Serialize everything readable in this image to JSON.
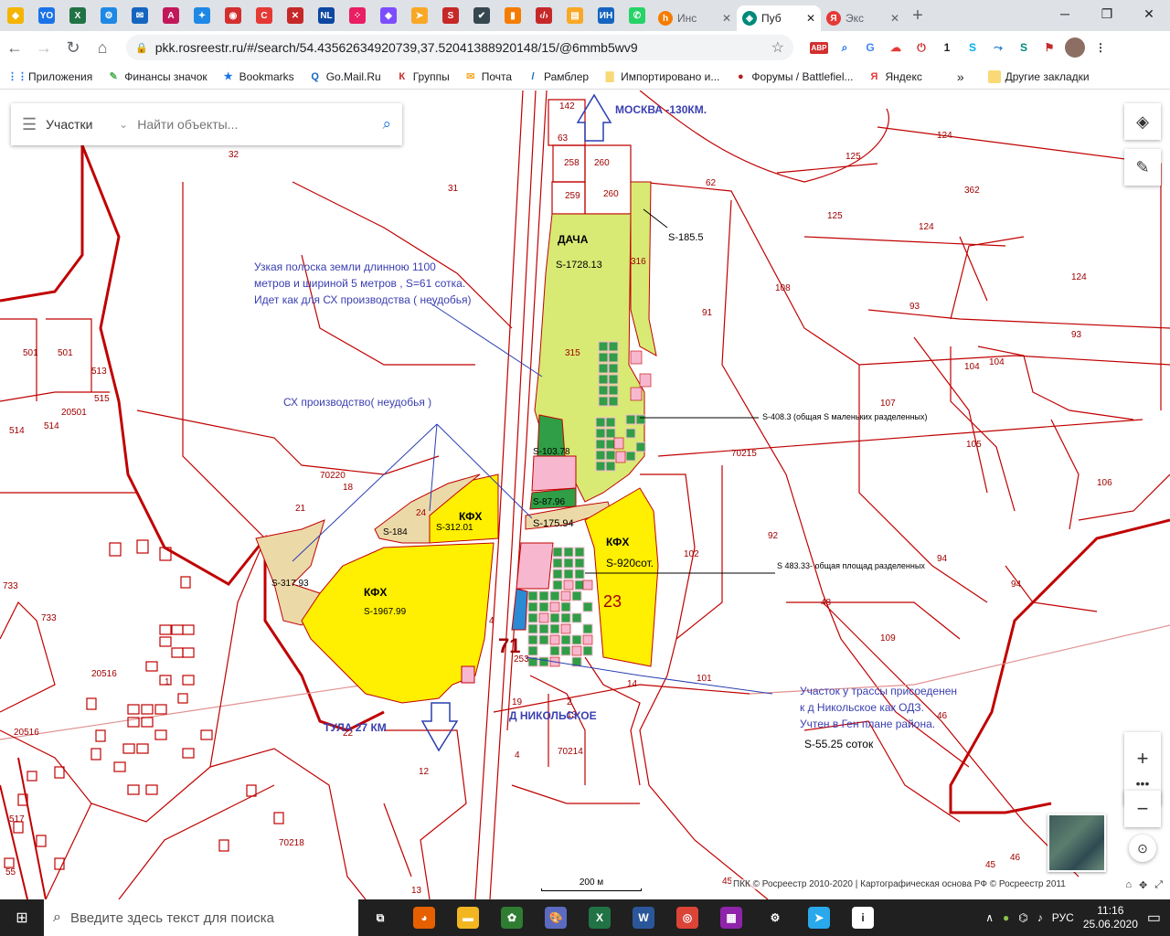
{
  "browser": {
    "tabs_icons": [
      {
        "name": "bookmark-yellow-icon",
        "glyph": "◆",
        "color": "#f5b400"
      },
      {
        "name": "yo-icon",
        "glyph": "YO",
        "color": "#1a73e8"
      },
      {
        "name": "excel-icon",
        "glyph": "X",
        "color": "#217346"
      },
      {
        "name": "gear-app-icon",
        "glyph": "⚙",
        "color": "#1e88e5"
      },
      {
        "name": "mail-icon",
        "glyph": "✉",
        "color": "#1565c0"
      },
      {
        "name": "font-a-icon",
        "glyph": "A",
        "color": "#c2185b"
      },
      {
        "name": "star-blue-icon",
        "glyph": "✦",
        "color": "#1e88e5"
      },
      {
        "name": "circle-red-icon",
        "glyph": "◉",
        "color": "#d32f2f"
      },
      {
        "name": "c-red-icon",
        "glyph": "C",
        "color": "#e53935"
      },
      {
        "name": "tool-red-icon",
        "glyph": "✕",
        "color": "#c62828"
      },
      {
        "name": "nl-icon",
        "glyph": "NL",
        "color": "#0d47a1"
      },
      {
        "name": "dots-icon",
        "glyph": "⁘",
        "color": "#e91e63"
      },
      {
        "name": "diamond-icon",
        "glyph": "◆",
        "color": "#7c4dff"
      },
      {
        "name": "arrow-icon",
        "glyph": "➤",
        "color": "#f9a825"
      },
      {
        "name": "s-red-icon",
        "glyph": "S",
        "color": "#c62828"
      },
      {
        "name": "check-icon",
        "glyph": "✔",
        "color": "#37474f"
      },
      {
        "name": "chart-icon",
        "glyph": "▮",
        "color": "#f57c00"
      },
      {
        "name": "code-icon",
        "glyph": "‹/›",
        "color": "#c62828"
      },
      {
        "name": "note-icon",
        "glyph": "▤",
        "color": "#f9a825"
      },
      {
        "name": "in-icon",
        "glyph": "ИН",
        "color": "#1565c0"
      },
      {
        "name": "whatsapp-icon",
        "glyph": "✆",
        "color": "#25d366"
      }
    ],
    "tabs": [
      {
        "label": "Инс",
        "icon": "h",
        "icon_color": "#f57c00",
        "active": false
      },
      {
        "label": "Пуб",
        "icon": "◈",
        "icon_color": "#00897b",
        "active": true
      },
      {
        "label": "Экс",
        "icon": "Я",
        "icon_color": "#e53935",
        "active": false
      }
    ],
    "url": "pkk.rosreestr.ru/#/search/54.43562634920739,37.52041388920148/15/@6mmb5wv9",
    "bookmarks": [
      {
        "label": "Приложения",
        "icon": "⋮⋮",
        "color": "#1a73e8"
      },
      {
        "label": "Финансы значок",
        "icon": "✎",
        "color": "#4caf50"
      },
      {
        "label": "Bookmarks",
        "icon": "★",
        "color": "#1a73e8"
      },
      {
        "label": "Go.Mail.Ru",
        "icon": "Q",
        "color": "#1565c0"
      },
      {
        "label": "Группы",
        "icon": "К",
        "color": "#c62828"
      },
      {
        "label": "Почта",
        "icon": "✉",
        "color": "#f9a825"
      },
      {
        "label": "Рамблер",
        "icon": "/",
        "color": "#1565c0"
      },
      {
        "label": "Импортировано и...",
        "icon": "▇",
        "color": "#f9d976"
      },
      {
        "label": "Форумы / Battlefiel...",
        "icon": "●",
        "color": "#b71c1c"
      },
      {
        "label": "Яндекс",
        "icon": "Я",
        "color": "#e53935"
      }
    ],
    "bookmarks_more": "»",
    "other_bookmarks": "Другие закладки"
  },
  "search": {
    "category": "Участки",
    "placeholder": "Найти объекты..."
  },
  "map": {
    "colors": {
      "kfh": "#ffef00",
      "dacha": "#d8ea74",
      "pink": "#f7b8cf",
      "green": "#2f9e46",
      "sand": "#ecd9a8",
      "boundary": "#c00000"
    },
    "parcel_numbers": [
      "142",
      "63",
      "258",
      "260",
      "259",
      "260",
      "62",
      "124",
      "125",
      "362",
      "32",
      "31",
      "125",
      "124",
      "124",
      "316",
      "93",
      "108",
      "91",
      "93",
      "501",
      "501",
      "513",
      "515",
      "315",
      "104",
      "104",
      "107",
      "20501",
      "514",
      "514",
      "105",
      "70215",
      "106",
      "70220",
      "18",
      "21",
      "24",
      "92",
      "94",
      "102",
      "733",
      "94",
      "48",
      "733",
      "4",
      "253",
      "109",
      "101",
      "20516",
      "1",
      "14",
      "19",
      "2",
      "13",
      "46",
      "20516",
      "22",
      "12",
      "4",
      "70214",
      "517",
      "55",
      "70218",
      "13",
      "45",
      "46",
      "45"
    ],
    "labels": {
      "moscow": "МОСКВА -130КМ.",
      "dacha": "ДАЧА",
      "dacha_area": "S-1728.13",
      "s185": "S-185.5",
      "strip_note": [
        "Узкая полоска земли длинною 1100",
        "метров и шириной 5 метров , S=61 сотка.",
        "Идет как для СХ производства ( неудобья)"
      ],
      "sx_note": "СХ производство( неудобья )",
      "s408": "S-408.3 (общая S маленьких разделенных)",
      "s103": "S-103.78",
      "s87": "S-87.96",
      "s175": "S-175.94",
      "kfh1": "КФХ",
      "s312": "S-312.01",
      "s184": "S-184",
      "kfh2": "КФХ",
      "s920": "S-920сот.",
      "s483": "S 483.33- общая площад разделенных",
      "s317": "S-317.93",
      "kfh3": "КФХ",
      "s1967": "S-1967.99",
      "n23": "23",
      "n71": "71",
      "ods_note": [
        "Участок у трассы присоеденен",
        "к д Никольское как ОДЗ.",
        "Учтен   в Ген плане района."
      ],
      "s55": "S-55.25 соток",
      "tula": "ТУЛА 27 КМ",
      "nikolskoe": "Д НИКОЛЬСКОЕ"
    },
    "scale": "200 м",
    "copyright": "ПКК © Росреестр 2010-2020 | Картографическая основа РФ © Росреестр 2011"
  },
  "taskbar": {
    "search_placeholder": "Введите здесь текст для поиска",
    "apps": [
      {
        "name": "task-view-icon",
        "glyph": "⧉",
        "color": "#202020"
      },
      {
        "name": "firefox-icon",
        "glyph": "◕",
        "color": "#e66000"
      },
      {
        "name": "explorer-icon",
        "glyph": "▬",
        "color": "#f2b620"
      },
      {
        "name": "green-app-icon",
        "glyph": "✿",
        "color": "#2e7d32"
      },
      {
        "name": "paint-icon",
        "glyph": "🎨",
        "color": "#5c6bc0"
      },
      {
        "name": "excel-app-icon",
        "glyph": "X",
        "color": "#217346"
      },
      {
        "name": "word-app-icon",
        "glyph": "W",
        "color": "#2b579a"
      },
      {
        "name": "chrome-icon",
        "glyph": "◎",
        "color": "#db4437"
      },
      {
        "name": "winrar-icon",
        "glyph": "▦",
        "color": "#8e24aa"
      },
      {
        "name": "settings-icon",
        "glyph": "⚙",
        "color": "#202020"
      },
      {
        "name": "telegram-icon",
        "glyph": "➤",
        "color": "#29a9eb"
      },
      {
        "name": "info-app-icon",
        "glyph": "i",
        "color": "#fff"
      }
    ],
    "language": "РУС",
    "time": "11:16",
    "date": "25.06.2020"
  }
}
